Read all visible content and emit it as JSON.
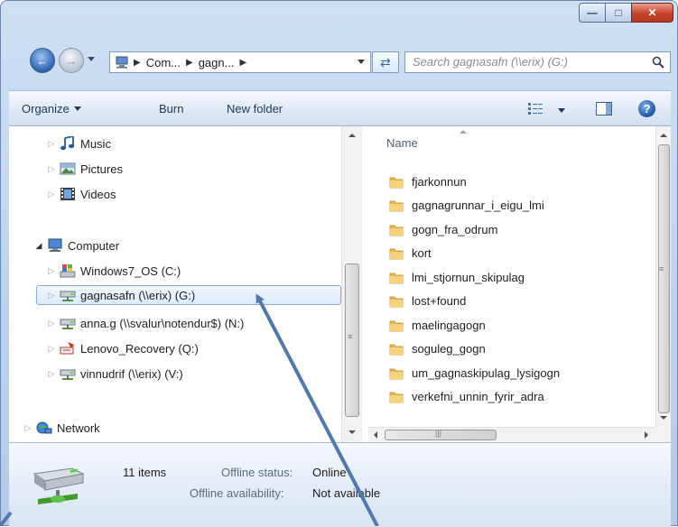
{
  "window": {
    "caption_buttons": [
      "minimize",
      "maximize",
      "close"
    ]
  },
  "address_bar": {
    "crumbs": [
      "Com...",
      "gagn..."
    ]
  },
  "search": {
    "placeholder": "Search gagnasafn (\\\\erix) (G:)"
  },
  "toolbar": {
    "organize": "Organize",
    "burn": "Burn",
    "new_folder": "New folder"
  },
  "nav_tree": {
    "libraries": [
      {
        "label": "Music",
        "icon": "music-icon"
      },
      {
        "label": "Pictures",
        "icon": "pictures-icon"
      },
      {
        "label": "Videos",
        "icon": "videos-icon"
      }
    ],
    "computer": {
      "label": "Computer",
      "icon": "computer-icon"
    },
    "drives": [
      {
        "label": "Windows7_OS (C:)",
        "icon": "windows-drive-icon"
      },
      {
        "label": "gagnasafn (\\\\erix) (G:)",
        "icon": "network-drive-icon",
        "selected": true
      },
      {
        "label": "anna.g (\\\\svalur\\notendur$) (N:)",
        "icon": "network-drive-icon"
      },
      {
        "label": "Lenovo_Recovery (Q:)",
        "icon": "recovery-drive-icon"
      },
      {
        "label": "vinnudrif (\\\\erix) (V:)",
        "icon": "network-drive-icon"
      }
    ],
    "network": {
      "label": "Network",
      "icon": "network-icon"
    }
  },
  "file_list": {
    "column_header": "Name",
    "items": [
      "fjarkonnun",
      "gagnagrunnar_i_eigu_lmi",
      "gogn_fra_odrum",
      "kort",
      "lmi_stjornun_skipulag",
      "lost+found",
      "maelingagogn",
      "soguleg_gogn",
      "um_gagnaskipulag_lysigogn",
      "verkefni_unnin_fyrir_adra"
    ]
  },
  "details_pane": {
    "item_count": "11 items",
    "offline_status_label": "Offline status:",
    "offline_status_value": "Online",
    "offline_availability_label": "Offline availability:",
    "offline_availability_value": "Not available"
  },
  "colors": {
    "arrow": "#4f79b0",
    "selection_border": "#84acdd",
    "folder": "#e8b84a"
  }
}
